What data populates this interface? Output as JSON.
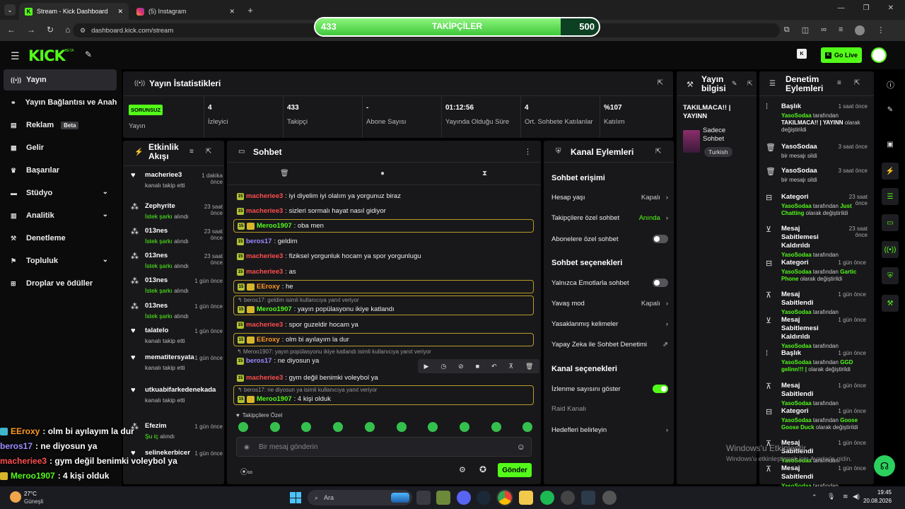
{
  "browser": {
    "tabs": [
      {
        "title": "Stream - Kick Dashboard"
      },
      {
        "title": "(5) Instagram"
      }
    ],
    "url": "dashboard.kick.com/stream"
  },
  "follow_goal": {
    "label": "TAKİPÇİLER",
    "current": "433",
    "target": "500",
    "progress": 0.866
  },
  "header": {
    "logo": "KICK",
    "logo_sup": "BETA",
    "go_live": "Go Live"
  },
  "sidebar": {
    "items": [
      {
        "label": "Yayın",
        "icon": "broadcast-icon",
        "active": true
      },
      {
        "label": "Yayın Bağlantısı ve Anahtarı",
        "icon": "link-icon"
      },
      {
        "label": "Reklam",
        "icon": "ad-icon",
        "badge": "Beta"
      },
      {
        "label": "Gelir",
        "icon": "revenue-icon"
      },
      {
        "label": "Başarılar",
        "icon": "trophy-icon"
      },
      {
        "label": "Stüdyo",
        "icon": "studio-icon",
        "chevron": true
      },
      {
        "label": "Analitik",
        "icon": "chart-icon",
        "chevron": true
      },
      {
        "label": "Denetleme",
        "icon": "wrench-icon"
      },
      {
        "label": "Topluluk",
        "icon": "community-icon",
        "chevron": true
      },
      {
        "label": "Droplar ve ödüller",
        "icon": "gift-icon"
      }
    ]
  },
  "stats": {
    "title": "Yayın İstatistikleri",
    "status_badge": "SORUNSUZ",
    "status_label": "Yayın",
    "items": [
      {
        "value": "4",
        "label": "İzleyici"
      },
      {
        "value": "433",
        "label": "Takipçi"
      },
      {
        "value": "-",
        "label": "Abone Sayısı"
      },
      {
        "value": "01:12:56",
        "label": "Yayında Olduğu Süre"
      },
      {
        "value": "4",
        "label": "Ort. Sohbete Katılanlar"
      },
      {
        "value": "%107",
        "label": "Katılım"
      }
    ]
  },
  "stream_info": {
    "title": "Yayın bilgisi",
    "stream_title": "TAKILMACA!! | YAYINN",
    "category": "Sadece Sohbet",
    "tag": "Turkish"
  },
  "activity": {
    "title": "Etkinlik Akışı",
    "items": [
      {
        "name": "macheriee3",
        "sub": "kanalı takip etti",
        "time": "1 dakika önce",
        "type": "follow"
      },
      {
        "name": "Zephyrite",
        "sub": "İstek şarkı",
        "sub2": "alındı",
        "time": "23 saat önce",
        "type": "song"
      },
      {
        "name": "013nes",
        "sub": "İstek şarkı",
        "sub2": "alındı",
        "time": "23 saat önce",
        "type": "song"
      },
      {
        "name": "013nes",
        "sub": "İstek şarkı",
        "sub2": "alındı",
        "time": "23 saat önce",
        "type": "song"
      },
      {
        "name": "013nes",
        "sub": "İstek şarkı",
        "sub2": "alındı",
        "time": "1 gün önce",
        "type": "song"
      },
      {
        "name": "013nes",
        "sub": "İstek şarkı",
        "sub2": "alındı",
        "time": "1 gün önce",
        "type": "song"
      },
      {
        "name": "talatelo",
        "sub": "kanalı takip etti",
        "time": "1 gün önce",
        "type": "follow"
      },
      {
        "name": "mematitersyatan",
        "sub": "kanalı takip etti",
        "time": "1 gün önce",
        "type": "follow"
      },
      {
        "name": "utkuabifarkedenekada",
        "sub": "kanalı takip etti",
        "time": "",
        "type": "follow"
      },
      {
        "name": "Efezim",
        "sub": "Şu iç",
        "sub2": "alındı",
        "time": "1 gün önce",
        "type": "song"
      },
      {
        "name": "selinekerbicer",
        "sub": "",
        "time": "1 gün önce",
        "type": "follow"
      }
    ]
  },
  "chat": {
    "title": "Sohbet",
    "messages": [
      {
        "user": "macheriee3",
        "color": "#ff4d4d",
        "text": ": iyi diyelim iyi olalım ya yorgunuz biraz"
      },
      {
        "user": "macheriee3",
        "color": "#ff4d4d",
        "text": ": sizleri sormalı hayat nasıl gidiyor"
      },
      {
        "user": "Meroo1907",
        "color": "#53fc18",
        "text": ": oba men",
        "highlight": true,
        "crown": true
      },
      {
        "user": "beros17",
        "color": "#9b8cff",
        "text": ": geldim"
      },
      {
        "user": "macheriee3",
        "color": "#ff4d4d",
        "text": ": fiziksel yorgunluk hocam ya spor yorgunlugu"
      },
      {
        "user": "macheriee3",
        "color": "#ff4d4d",
        "text": ": as"
      },
      {
        "user": "EEroxy",
        "color": "#ff9a1f",
        "text": ": he",
        "highlight": true,
        "crown": true
      },
      {
        "user": "Meroo1907",
        "color": "#53fc18",
        "text": ": yayın popülasyonu ikiye katlandı",
        "highlight": true,
        "crown": true,
        "reply": "beros17: geldim isimli kullanıcıya yanıt veriyor"
      },
      {
        "user": "macheriee3",
        "color": "#ff4d4d",
        "text": ": spor guzeldir hocam ya"
      },
      {
        "user": "EEroxy",
        "color": "#ff9a1f",
        "text": ": olm bi ayılayım la dur",
        "highlight": true,
        "crown": true
      },
      {
        "user": "beros17",
        "color": "#9b8cff",
        "text": ": ne diyosun ya",
        "reply": "Meroo1907: yayın popülasyonu ikiye katlandı isimli kullanıcıya yanıt veriyor"
      },
      {
        "user": "macheriee3",
        "color": "#ff4d4d",
        "text": ": gym değil benimki voleybol ya"
      },
      {
        "user": "Meroo1907",
        "color": "#53fc18",
        "text": ": 4 kişi olduk",
        "highlight": true,
        "crown": true,
        "reply": "beros17: ne diyosun ya isimli kullanıcıya yanıt veriyor"
      }
    ],
    "followers_only": "Takipçilere Özel",
    "input_placeholder": "Bir mesaj gönderin",
    "send": "Gönder"
  },
  "channel_actions": {
    "title": "Kanal Eylemleri",
    "sec1": "Sohbet erişimi",
    "account_age": {
      "label": "Hesap yaşı",
      "value": "Kapalı"
    },
    "followers_chat": {
      "label": "Takipçilere özel sohbet",
      "value": "Anında"
    },
    "subs_chat": {
      "label": "Abonelere özel sohbet",
      "on": false
    },
    "sec2": "Sohbet seçenekleri",
    "emote_only": {
      "label": "Yalnızca Emotlarla sohbet",
      "on": false
    },
    "slow": {
      "label": "Yavaş mod",
      "value": "Kapalı"
    },
    "banned": {
      "label": "Yasaklanmış kelimeler"
    },
    "ai": {
      "label": "Yapay Zeka ile Sohbet Denetimi"
    },
    "sec3": "Kanal seçenekleri",
    "viewers": {
      "label": "İzlenme sayısını göster",
      "on": true
    },
    "raid": {
      "label": "Raid Kanalı"
    },
    "goals": {
      "label": "Hedefleri belirleyin"
    }
  },
  "mod_actions": {
    "title": "Denetim Eylemleri",
    "by": "YasoSodaa",
    "items": [
      {
        "title": "Başlık",
        "time": "1 saat önce",
        "pre": "tarafından",
        "b1": "TAKILMACA!! | YAYINN",
        "post": "olarak değiştirildi",
        "icon": "title-icon"
      },
      {
        "title": "YasoSodaa",
        "time": "3 saat önce",
        "desc": "bir mesajı sildi",
        "icon": "trash-icon"
      },
      {
        "title": "YasoSodaa",
        "time": "3 saat önce",
        "desc": "bir mesajı sildi",
        "icon": "trash-icon"
      },
      {
        "title": "Kategori",
        "time": "23 saat önce",
        "pre": "tarafından",
        "b1": "Just Chatting",
        "post": "olarak değiştirildi",
        "icon": "category-icon"
      },
      {
        "title": "Mesaj Sabitlemesi Kaldırıldı",
        "time": "23 saat önce",
        "pre": "tarafından",
        "icon": "unpin-icon"
      },
      {
        "title": "Kategori",
        "time": "1 gün önce",
        "pre": "tarafından",
        "b1": "Gartic Phone",
        "post": "olarak değiştirildi",
        "icon": "category-icon"
      },
      {
        "title": "Mesaj Sabitlendi",
        "time": "1 gün önce",
        "pre": "tarafından",
        "icon": "pin-icon"
      },
      {
        "title": "Mesaj Sabitlemesi Kaldırıldı",
        "time": "1 gün önce",
        "pre": "tarafından",
        "icon": "unpin-icon"
      },
      {
        "title": "Başlık",
        "time": "1 gün önce",
        "pre": "tarafından",
        "b1": "GGD gelinn!!! |",
        "post": "olarak değiştirildi",
        "icon": "title-icon"
      },
      {
        "title": "Mesaj Sabitlendi",
        "time": "1 gün önce",
        "pre": "tarafından",
        "icon": "pin-icon"
      },
      {
        "title": "Kategori",
        "time": "1 gün önce",
        "pre": "tarafından",
        "b1": "Goose Goose Duck",
        "post": "olarak değiştirildi",
        "icon": "category-icon"
      },
      {
        "title": "Mesaj Sabitlendi",
        "time": "1 gün önce",
        "pre": "tarafından",
        "icon": "pin-icon"
      },
      {
        "title": "Mesaj Sabitlendi",
        "time": "1 gün önce",
        "pre": "tarafından",
        "icon": "pin-icon"
      }
    ]
  },
  "overlay_chat": [
    {
      "user": "EEroxy",
      "color": "#ff9a1f",
      "text": ": olm bi ayılayım la dur",
      "icon": true
    },
    {
      "user": "beros17",
      "color": "#9b8cff",
      "text": ": ne diyosun ya"
    },
    {
      "user": "macheriee3",
      "color": "#ff4d4d",
      "text": ": gym değil benimki voleybol ya"
    },
    {
      "user": "Meroo1907",
      "color": "#53fc18",
      "text": ": 4 kişi olduk",
      "icon": true
    }
  ],
  "windows_watermark": {
    "line1": "Windows'u Etkinleştir",
    "line2": "Windows'u etkinleştirmek için Ayarlar'a gidin."
  },
  "taskbar": {
    "temp": "27°C",
    "weather": "Güneşli",
    "search": "Ara",
    "time": "19:45",
    "date": "20.08.2026"
  },
  "colors": {
    "accent": "#53fc18",
    "panel": "#18181b",
    "bg": "#000000"
  }
}
